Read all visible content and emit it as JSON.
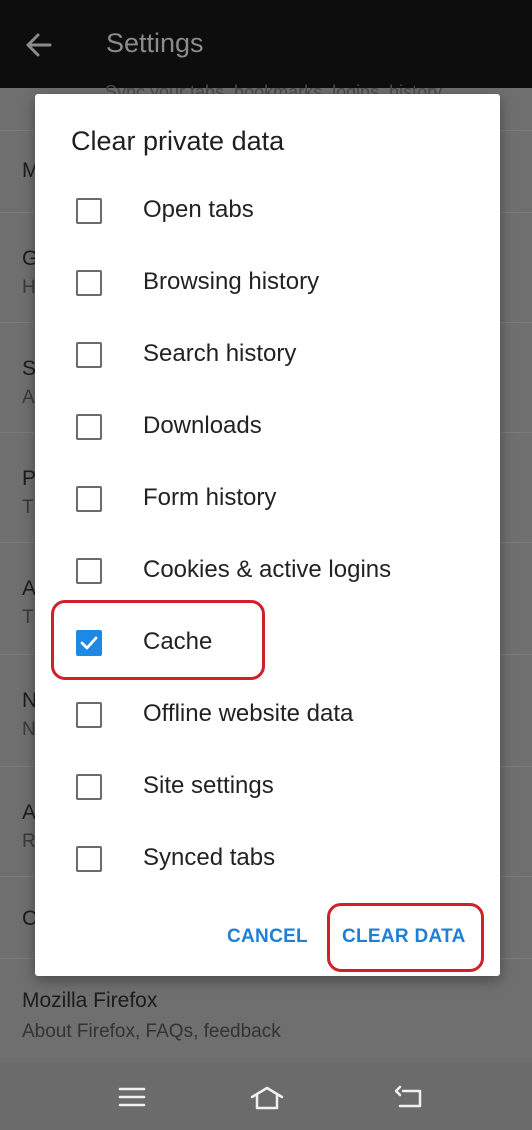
{
  "appbar": {
    "title": "Settings",
    "back_icon": "arrow-left-icon"
  },
  "background_list": {
    "top_subtitle": "Sync your tabs, bookmarks, logins, history",
    "rows": [
      {
        "title": "M",
        "subtitle": ""
      },
      {
        "title": "G",
        "subtitle": "H"
      },
      {
        "title": "S",
        "subtitle": "A"
      },
      {
        "title": "P",
        "subtitle": "T"
      },
      {
        "title": "A",
        "subtitle": "T"
      },
      {
        "title": "N",
        "subtitle": "N"
      },
      {
        "title": "A",
        "subtitle": "R"
      },
      {
        "title": "C",
        "subtitle": ""
      }
    ],
    "footer": {
      "title": "Mozilla Firefox",
      "subtitle": "About Firefox, FAQs, feedback"
    }
  },
  "dialog": {
    "title": "Clear private data",
    "options": [
      {
        "label": "Open tabs",
        "checked": false
      },
      {
        "label": "Browsing history",
        "checked": false
      },
      {
        "label": "Search history",
        "checked": false
      },
      {
        "label": "Downloads",
        "checked": false
      },
      {
        "label": "Form history",
        "checked": false
      },
      {
        "label": "Cookies & active logins",
        "checked": false
      },
      {
        "label": "Cache",
        "checked": true
      },
      {
        "label": "Offline website data",
        "checked": false
      },
      {
        "label": "Site settings",
        "checked": false
      },
      {
        "label": "Synced tabs",
        "checked": false
      }
    ],
    "cancel_label": "CANCEL",
    "clear_label": "CLEAR DATA"
  },
  "colors": {
    "accent": "#1e88e5",
    "highlight": "#d0202a",
    "appbar": "#0d0d0d"
  },
  "navbar": {
    "icons": [
      "menu-icon",
      "home-icon",
      "back-icon"
    ]
  }
}
